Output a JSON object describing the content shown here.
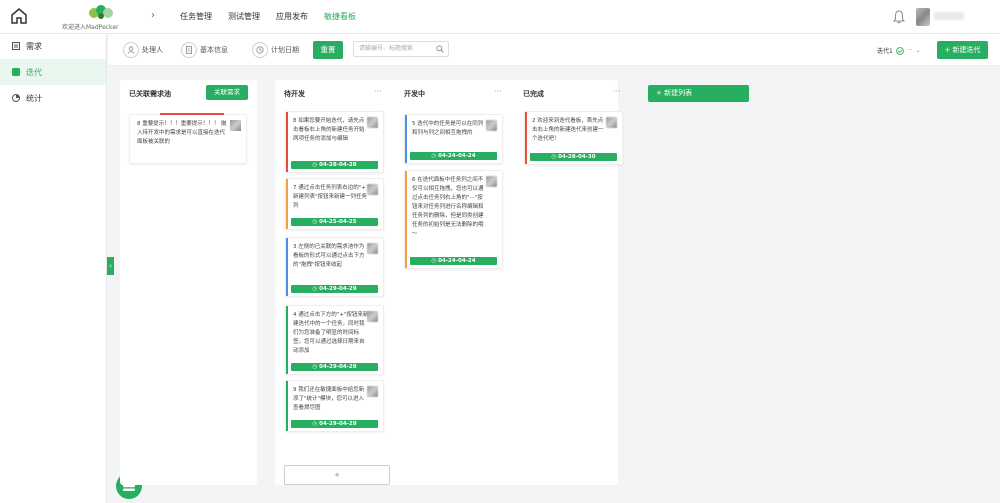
{
  "header": {
    "logo_text": "欢迎进入MadPecker",
    "nav": [
      "任务管理",
      "测试管理",
      "应用发布",
      "敏捷看板"
    ],
    "active_nav": 3
  },
  "sidebar": {
    "items": [
      {
        "label": "需求",
        "icon": "list-icon"
      },
      {
        "label": "迭代",
        "icon": "iteration-icon"
      },
      {
        "label": "统计",
        "icon": "pie-chart-icon"
      }
    ],
    "active": 1
  },
  "filters": {
    "assignee": "处理人",
    "basic_info": "基本信息",
    "planned_date": "计划日期",
    "reset": "重置",
    "search_placeholder": "请输编号、标题搜索"
  },
  "iteration": {
    "label": "迭代1",
    "more": "···",
    "new_button": "+ 新建迭代"
  },
  "columns": {
    "backlog": {
      "title": "已关联需求池",
      "button": "关联需求"
    },
    "todo": {
      "title": "待开发",
      "more": "···"
    },
    "doing": {
      "title": "开发中",
      "more": "···"
    },
    "done": {
      "title": "已完成",
      "more": "···"
    },
    "new_list": "+ 新建列表"
  },
  "backlog_card": {
    "text": "8 重要提示！！！重要提示！！！ 嵌入待开发中的需求是可以直接在迭代面板被关联的"
  },
  "cards": [
    {
      "id": "todo-8",
      "col": "todo",
      "text": "8 如果您要开始迭代，请先点击看板右上角的新建任务开始两项任务的添加与编辑",
      "date": "04-28-04-28",
      "color": "#e74c3c"
    },
    {
      "id": "todo-7",
      "col": "todo",
      "text": "7 通过点击任务列表右边的\"+ 新建列表\"按钮来新建一列任务列",
      "date": "04-25-04-25",
      "color": "#f0a040"
    },
    {
      "id": "todo-3",
      "col": "todo",
      "text": "3 左侧的已关联的需求池作为看板的形式可以通过点击下方的\"拖拽\"按钮来收起",
      "date": "04-29-04-29",
      "color": "#4a90e2"
    },
    {
      "id": "todo-4",
      "col": "todo",
      "text": "4 通过点击下方的\"+\"按钮来新建迭代中的一个任务，同时我们为您准备了明显的时间标签，您可以通过选择日期来自动添加",
      "date": "04-29-04-29",
      "color": "#27ae60"
    },
    {
      "id": "todo-9",
      "col": "todo",
      "text": "9 我们还在敏捷面板中给您新添了\"统计\"模块，您可以进入查看燃尽图",
      "date": "04-29-04-29",
      "color": "#27ae60"
    },
    {
      "id": "doing-5",
      "col": "doing",
      "text": "5 迭代中的任务是可以在同列和列与列之间相互拖拽的",
      "date": "04-24-04-24",
      "color": "#4a90e2"
    },
    {
      "id": "doing-6",
      "col": "doing",
      "text": "6 在迭代面板中任务列之间不仅可以相互拖拽，您也可以通过点击任务列右上角的\"···\"按钮来对任务列进行名称编辑和任务列的删除，但是同类创建任务的初始列是无法删除的哦～",
      "date": "04-24-04-24",
      "color": "#f0a040"
    },
    {
      "id": "done-2",
      "col": "done",
      "text": "2 欢迎来到迭代看板，首先点击右上角的新建迭代来创建一个迭代吧！",
      "date": "04-28-04-30",
      "color": "#e74c3c"
    }
  ],
  "add_task": "+",
  "colors": {
    "accent": "#27ae60",
    "red": "#e74c3c",
    "orange": "#f0a040",
    "blue": "#4a90e2"
  }
}
